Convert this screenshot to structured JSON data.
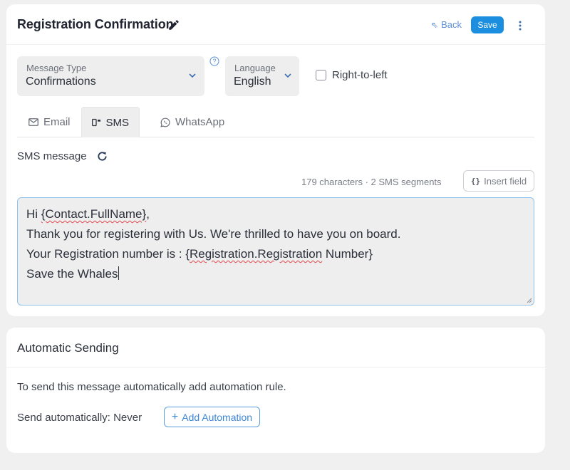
{
  "header": {
    "title": "Registration Confirmation",
    "back_label": "Back",
    "save_label": "Save"
  },
  "message_type": {
    "label": "Message Type",
    "value": "Confirmations"
  },
  "language": {
    "label": "Language",
    "value": "English"
  },
  "rtl": {
    "label": "Right-to-left",
    "checked": false
  },
  "tabs": [
    {
      "label": "Email",
      "icon": "mail-icon",
      "active": false
    },
    {
      "label": "SMS",
      "icon": "sms-icon",
      "active": true
    },
    {
      "label": "WhatsApp",
      "icon": "whatsapp-icon",
      "active": false
    }
  ],
  "sms": {
    "label": "SMS message",
    "char_count": "179 characters · 2 SMS segments",
    "insert_field_label": "Insert field",
    "lines": {
      "l1_prefix": "Hi ",
      "l1_field": "{Contact.FullName}",
      "l1_suffix": ",",
      "l2": "Thank you for registering with Us. We're thrilled to have you on board.",
      "l3_prefix": "Your Registration number is : {",
      "l3_field": "Registration.Registration",
      "l3_suffix": " Number}",
      "l4": "Save the Whales"
    }
  },
  "automation": {
    "title": "Automatic Sending",
    "description": "To send this message automatically add automation rule.",
    "send_status": "Send automatically: Never",
    "add_label": "Add Automation"
  },
  "colors": {
    "accent": "#1b8ee0",
    "link": "#5b8fd6",
    "field_bg": "#eeeeee",
    "focus_border": "#8ec2ec"
  }
}
